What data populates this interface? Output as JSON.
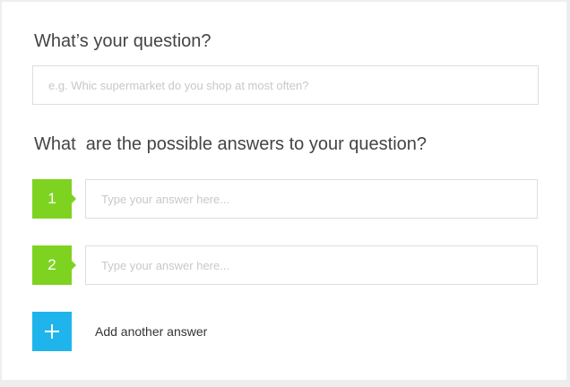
{
  "question_section": {
    "heading": "What’s your question?",
    "input_value": "",
    "input_placeholder": "e.g. Whic supermarket do you shop at most often?"
  },
  "answers_section": {
    "heading": "What  are the possible answers to your question?",
    "answers": [
      {
        "number": "1",
        "value": "",
        "placeholder": "Type your answer here..."
      },
      {
        "number": "2",
        "value": "",
        "placeholder": "Type your answer here..."
      }
    ],
    "add_label": "Add another answer"
  },
  "colors": {
    "badge_green": "#7ed321",
    "add_blue": "#1fb5ec",
    "border": "#dedede",
    "heading_text": "#444444"
  },
  "icons": {
    "add": "plus-icon"
  }
}
